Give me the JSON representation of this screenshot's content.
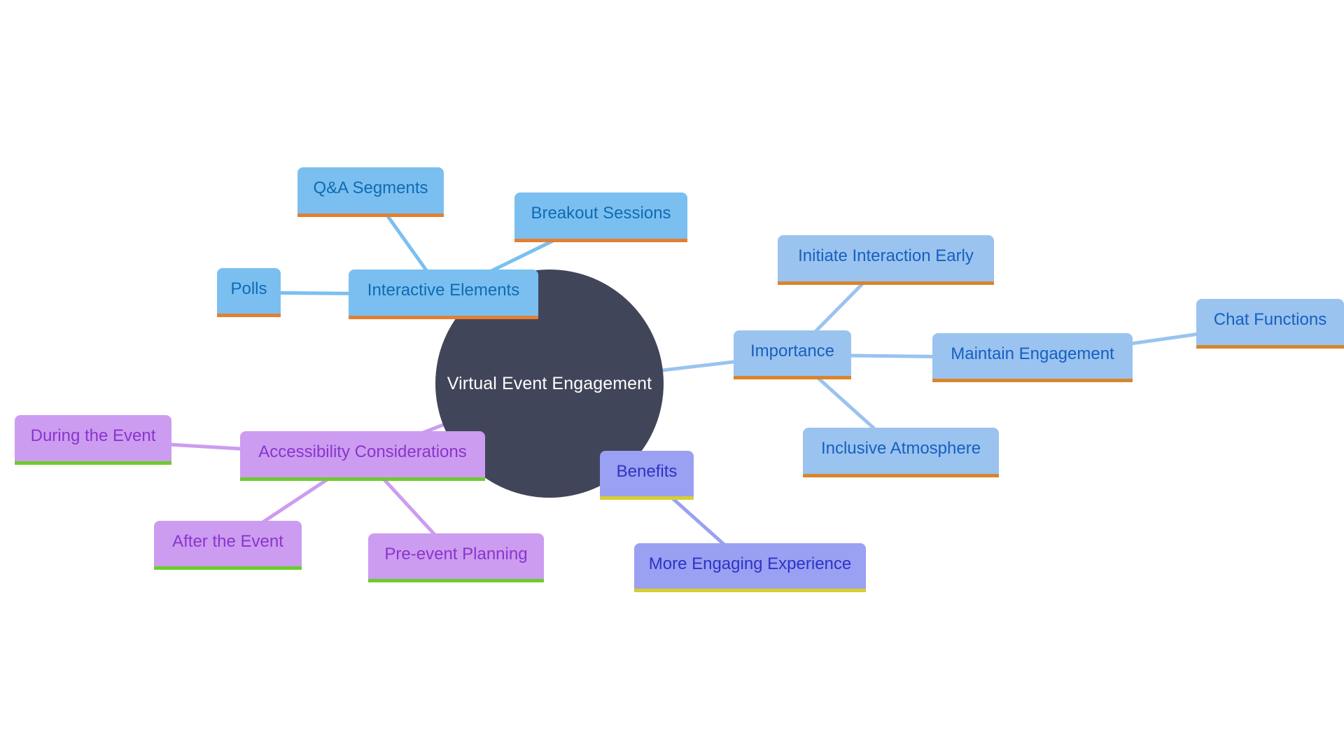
{
  "diagram": {
    "type": "mindmap",
    "root": {
      "label": "Virtual Event Engagement",
      "color": "#414559"
    },
    "branches": {
      "interactive": {
        "label": "Interactive Elements",
        "color": "#7bbff0",
        "edge_color": "#7bbff0",
        "children": {
          "qa": "Q&A Segments",
          "breakout": "Breakout Sessions",
          "polls": "Polls"
        }
      },
      "importance": {
        "label": "Importance",
        "color": "#9ac3ef",
        "edge_color": "#9ac3ef",
        "children": {
          "initiate": "Initiate Interaction Early",
          "maintain": "Maintain Engagement",
          "inclusive": "Inclusive Atmosphere"
        },
        "grandchildren": {
          "chat": "Chat Functions"
        }
      },
      "benefits": {
        "label": "Benefits",
        "color": "#9aa0f2",
        "edge_color": "#9aa0f2",
        "children": {
          "more": "More Engaging Experience"
        }
      },
      "accessibility": {
        "label": "Accessibility Considerations",
        "color": "#cc9cf0",
        "edge_color": "#cc9cf0",
        "children": {
          "during": "During the Event",
          "after": "After the Event",
          "pre": "Pre-event Planning"
        }
      }
    },
    "edges": [
      {
        "from": "root",
        "to": "interactive"
      },
      {
        "from": "interactive",
        "to": "qa"
      },
      {
        "from": "interactive",
        "to": "breakout"
      },
      {
        "from": "interactive",
        "to": "polls"
      },
      {
        "from": "root",
        "to": "importance"
      },
      {
        "from": "importance",
        "to": "initiate"
      },
      {
        "from": "importance",
        "to": "maintain"
      },
      {
        "from": "importance",
        "to": "inclusive"
      },
      {
        "from": "maintain",
        "to": "chat"
      },
      {
        "from": "root",
        "to": "benefits"
      },
      {
        "from": "benefits",
        "to": "more"
      },
      {
        "from": "root",
        "to": "accessibility"
      },
      {
        "from": "accessibility",
        "to": "during"
      },
      {
        "from": "accessibility",
        "to": "after"
      },
      {
        "from": "accessibility",
        "to": "pre"
      }
    ]
  }
}
